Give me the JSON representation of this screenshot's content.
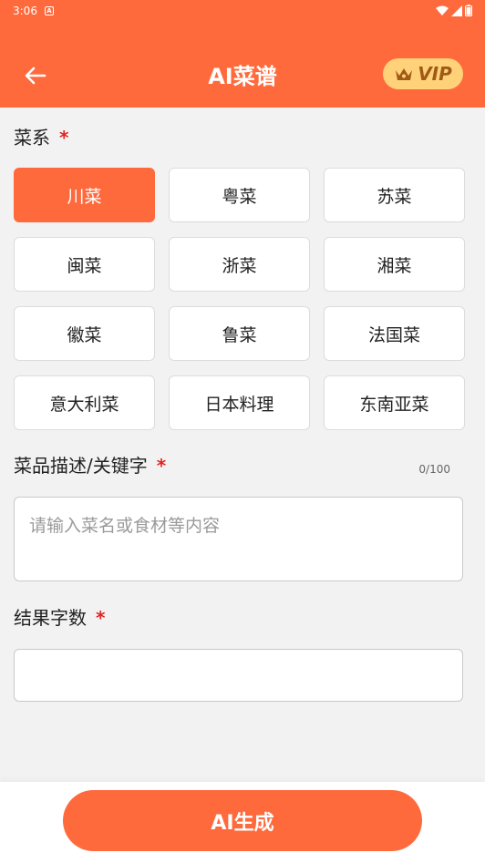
{
  "status_bar": {
    "time": "3:06",
    "notification_icon": "app-notification-icon",
    "icons": [
      "wifi-icon",
      "signal-icon",
      "battery-icon"
    ]
  },
  "header": {
    "title": "AI菜谱",
    "vip_label": "VIP",
    "accent_color": "#ff6a3d",
    "vip_color": "#ffd27a"
  },
  "cuisine": {
    "label": "菜系",
    "required": "*",
    "selected_index": 0,
    "options": [
      "川菜",
      "粤菜",
      "苏菜",
      "闽菜",
      "浙菜",
      "湘菜",
      "徽菜",
      "鲁菜",
      "法国菜",
      "意大利菜",
      "日本料理",
      "东南亚菜"
    ]
  },
  "description": {
    "label": "菜品描述/关键字",
    "required": "*",
    "counter": "0/100",
    "value": "",
    "placeholder": "请输入菜名或食材等内容"
  },
  "word_count": {
    "label": "结果字数",
    "required": "*",
    "value": "",
    "placeholder": ""
  },
  "generate_button": {
    "label": "AI生成"
  }
}
